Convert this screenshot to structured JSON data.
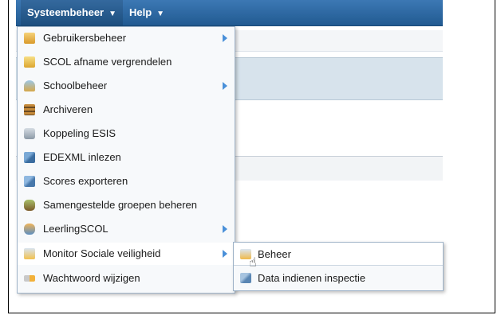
{
  "menubar": {
    "items": [
      {
        "label": "Systeembeheer",
        "caret": "▼"
      },
      {
        "label": "Help",
        "caret": "▼"
      }
    ]
  },
  "dropdown": {
    "items": [
      {
        "label": "Gebruikersbeheer",
        "icon": "user-folder-icon",
        "submenu": true
      },
      {
        "label": "SCOL afname vergrendelen",
        "icon": "lock-folder-icon",
        "submenu": false
      },
      {
        "label": "Schoolbeheer",
        "icon": "school-icon",
        "submenu": true
      },
      {
        "label": "Archiveren",
        "icon": "archive-icon",
        "submenu": false
      },
      {
        "label": "Koppeling ESIS",
        "icon": "link-icon",
        "submenu": false
      },
      {
        "label": "EDEXML inlezen",
        "icon": "import-icon",
        "submenu": false
      },
      {
        "label": "Scores exporteren",
        "icon": "export-icon",
        "submenu": false
      },
      {
        "label": "Samengestelde groepen beheren",
        "icon": "groups-icon",
        "submenu": false
      },
      {
        "label": "LeerlingSCOL",
        "icon": "student-icon",
        "submenu": true
      },
      {
        "label": "Monitor Sociale veiligheid",
        "icon": "monitor-icon",
        "submenu": true
      },
      {
        "label": "Wachtwoord wijzigen",
        "icon": "key-icon",
        "submenu": false
      }
    ]
  },
  "submenu": {
    "items": [
      {
        "label": "Beheer",
        "icon": "settings-icon"
      },
      {
        "label": "Data indienen inspectie",
        "icon": "upload-icon"
      }
    ]
  }
}
